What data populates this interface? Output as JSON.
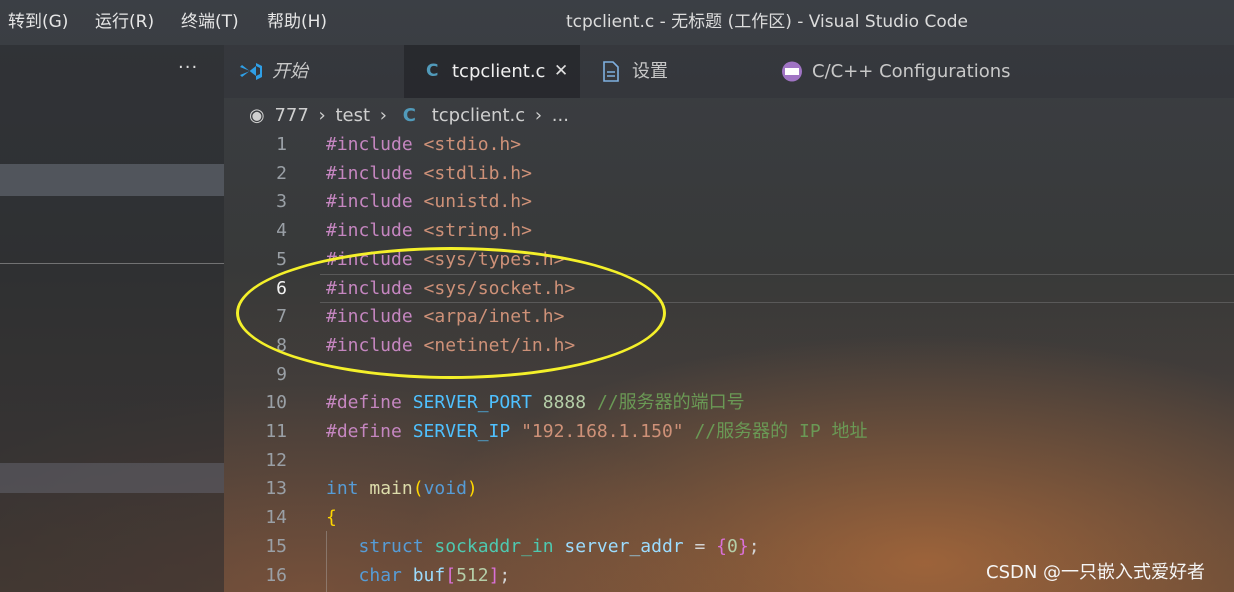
{
  "menu": [
    "转到(G)",
    "运行(R)",
    "终端(T)",
    "帮助(H)"
  ],
  "window_title": "tcpclient.c - 无标题 (工作区) - Visual Studio Code",
  "sidebar": {
    "more": "···"
  },
  "tabs": [
    {
      "label": "开始",
      "icon": "vscode-logo-icon"
    },
    {
      "label": "tcpclient.c",
      "icon": "c-file-icon",
      "close": "✕"
    },
    {
      "label": "设置",
      "icon": "file-icon"
    },
    {
      "label": "C/C++ Configurations",
      "icon": "cpp-config-icon"
    }
  ],
  "breadcrumb": {
    "folder": "777",
    "sub": "test",
    "file": "tcpclient.c",
    "more": "...",
    "sep": "›"
  },
  "code_lines": [
    {
      "n": "1",
      "tokens": [
        [
          "pp",
          "#include "
        ],
        [
          "hdr",
          "<stdio.h>"
        ]
      ]
    },
    {
      "n": "2",
      "tokens": [
        [
          "pp",
          "#include "
        ],
        [
          "hdr",
          "<stdlib.h>"
        ]
      ]
    },
    {
      "n": "3",
      "tokens": [
        [
          "pp",
          "#include "
        ],
        [
          "hdr",
          "<unistd.h>"
        ]
      ]
    },
    {
      "n": "4",
      "tokens": [
        [
          "pp",
          "#include "
        ],
        [
          "hdr",
          "<string.h>"
        ]
      ]
    },
    {
      "n": "5",
      "tokens": [
        [
          "pp",
          "#include "
        ],
        [
          "hdr",
          "<sys/types.h>"
        ]
      ]
    },
    {
      "n": "6",
      "tokens": [
        [
          "pp",
          "#include "
        ],
        [
          "hdr",
          "<sys/socket.h>"
        ]
      ]
    },
    {
      "n": "7",
      "tokens": [
        [
          "pp",
          "#include "
        ],
        [
          "hdr",
          "<arpa/inet.h>"
        ]
      ]
    },
    {
      "n": "8",
      "tokens": [
        [
          "pp",
          "#include "
        ],
        [
          "hdr",
          "<netinet/in.h>"
        ]
      ]
    },
    {
      "n": "9",
      "tokens": []
    },
    {
      "n": "10",
      "tokens": [
        [
          "pp",
          "#define "
        ],
        [
          "mac",
          "SERVER_PORT "
        ],
        [
          "num",
          "8888 "
        ],
        [
          "cmt",
          "//服务器的端口号"
        ]
      ]
    },
    {
      "n": "11",
      "tokens": [
        [
          "pp",
          "#define "
        ],
        [
          "mac",
          "SERVER_IP "
        ],
        [
          "str",
          "\"192.168.1.150\" "
        ],
        [
          "cmt",
          "//服务器的 IP 地址"
        ]
      ]
    },
    {
      "n": "12",
      "tokens": []
    },
    {
      "n": "13",
      "tokens": [
        [
          "kw",
          "int "
        ],
        [
          "fn",
          "main"
        ],
        [
          "br1",
          "("
        ],
        [
          "kw",
          "void"
        ],
        [
          "br1",
          ")"
        ]
      ]
    },
    {
      "n": "14",
      "tokens": [
        [
          "br1",
          "{"
        ]
      ]
    },
    {
      "n": "15",
      "tokens": [
        [
          "pun",
          "   "
        ],
        [
          "kw",
          "struct "
        ],
        [
          "typ",
          "sockaddr_in "
        ],
        [
          "var",
          "server_addr "
        ],
        [
          "pun",
          "= "
        ],
        [
          "br2",
          "{"
        ],
        [
          "num",
          "0"
        ],
        [
          "br2",
          "}"
        ],
        [
          "pun",
          ";"
        ]
      ]
    },
    {
      "n": "16",
      "tokens": [
        [
          "pun",
          "   "
        ],
        [
          "kw",
          "char "
        ],
        [
          "var",
          "buf"
        ],
        [
          "br2",
          "["
        ],
        [
          "num",
          "512"
        ],
        [
          "br2",
          "]"
        ],
        [
          "pun",
          ";"
        ]
      ]
    }
  ],
  "current_line": "6",
  "watermark": "CSDN @一只嵌入式爱好者"
}
